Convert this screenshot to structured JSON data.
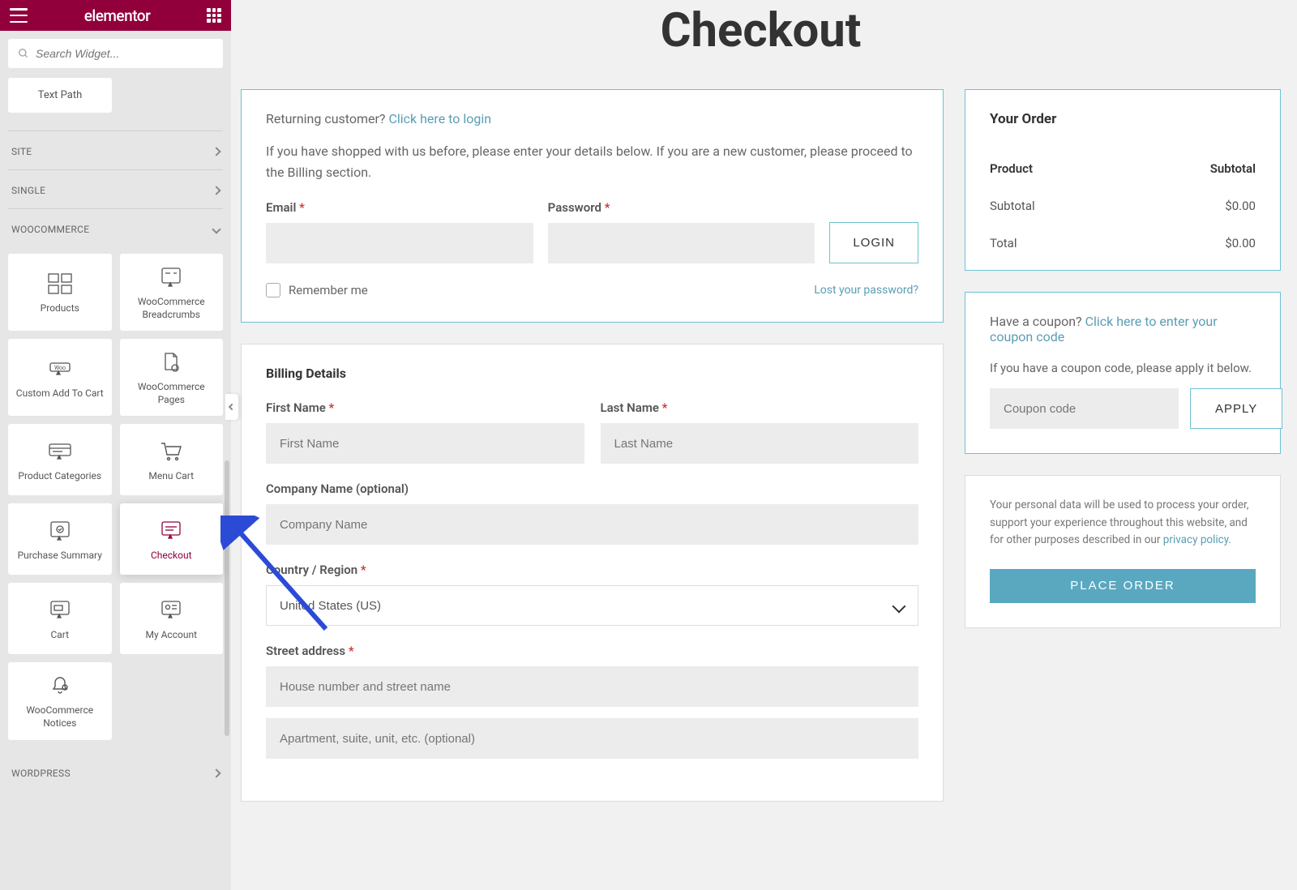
{
  "brand": "elementor",
  "search": {
    "placeholder": "Search Widget..."
  },
  "text_path_label": "Text Path",
  "nav": {
    "site": "SITE",
    "single": "SINGLE",
    "woo": "WOOCOMMERCE",
    "wp": "WORDPRESS"
  },
  "widgets": {
    "products": "Products",
    "breadcrumbs": "WooCommerce Breadcrumbs",
    "custom_add": "Custom Add To Cart",
    "woo_pages": "WooCommerce Pages",
    "categories": "Product Categories",
    "menu_cart": "Menu Cart",
    "purchase_summary": "Purchase Summary",
    "checkout": "Checkout",
    "cart": "Cart",
    "my_account": "My Account",
    "woo_notices": "WooCommerce Notices"
  },
  "page_title": "Checkout",
  "login_panel": {
    "returning": "Returning customer?",
    "returning_link": "Click here to login",
    "note": "If you have shopped with us before, please enter your details below. If you are a new customer, please proceed to the Billing section.",
    "email_label": "Email",
    "password_label": "Password",
    "login_btn": "LOGIN",
    "remember": "Remember me",
    "lost_password": "Lost your password?"
  },
  "billing": {
    "heading": "Billing Details",
    "first_name": "First Name",
    "first_name_ph": "First Name",
    "last_name": "Last Name",
    "last_name_ph": "Last Name",
    "company": "Company Name (optional)",
    "company_ph": "Company Name",
    "country": "Country / Region",
    "country_value": "United States (US)",
    "street": "Street address",
    "street_ph1": "House number and street name",
    "street_ph2": "Apartment, suite, unit, etc. (optional)"
  },
  "order": {
    "heading": "Your Order",
    "product": "Product",
    "subtotal_label": "Subtotal",
    "subtotal_value": "$0.00",
    "total_label": "Total",
    "total_value": "$0.00"
  },
  "coupon": {
    "have": "Have a coupon?",
    "link": "Click here to enter your coupon code",
    "note": "If you have a coupon code, please apply it below.",
    "placeholder": "Coupon code",
    "apply": "APPLY"
  },
  "place_order": {
    "privacy": "Your personal data will be used to process your order, support your experience throughout this website, and for other purposes described in our ",
    "privacy_link": "privacy policy",
    "btn": "PLACE ORDER"
  }
}
